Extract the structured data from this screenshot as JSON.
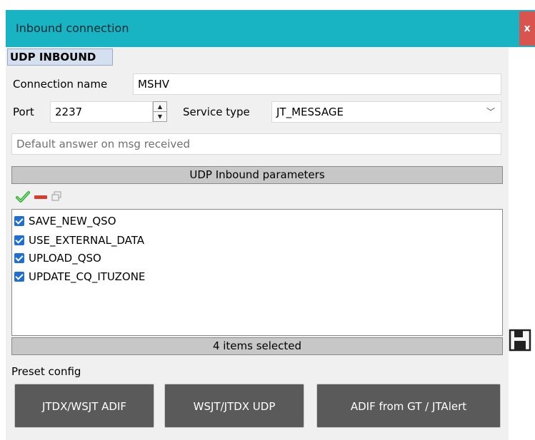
{
  "window": {
    "title": "Inbound connection",
    "close_label": "x"
  },
  "group": {
    "title": "UDP INBOUND"
  },
  "form": {
    "connection_name_label": "Connection name",
    "connection_name_value": "MSHV",
    "port_label": "Port",
    "port_value": "2237",
    "service_type_label": "Service type",
    "service_type_value": "JT_MESSAGE",
    "default_answer_placeholder": "Default answer on msg received"
  },
  "parameters": {
    "header": "UDP Inbound parameters",
    "toolbar_icons": [
      "check-icon",
      "remove-icon",
      "copy-icon"
    ],
    "items": [
      {
        "label": "SAVE_NEW_QSO",
        "checked": true
      },
      {
        "label": "USE_EXTERNAL_DATA",
        "checked": true
      },
      {
        "label": "UPLOAD_QSO",
        "checked": true
      },
      {
        "label": "UPDATE_CQ_ITUZONE",
        "checked": true
      }
    ],
    "status": "4 items selected"
  },
  "preset": {
    "label": "Preset config",
    "buttons": [
      "JTDX/WSJT ADIF",
      "WSJT/JTDX UDP",
      "ADIF from GT / JTAlert"
    ]
  },
  "colors": {
    "titlebar": "#19b4c3",
    "close": "#d9534f",
    "checkbox": "#1f6fd0",
    "preset_button": "#5a5a5a"
  }
}
